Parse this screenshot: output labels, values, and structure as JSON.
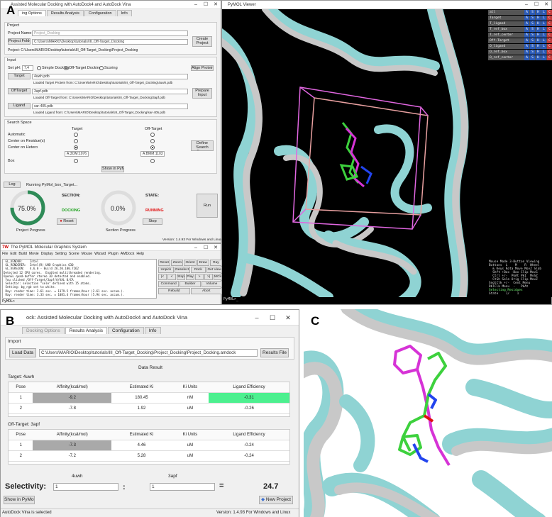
{
  "panels": {
    "a": "A",
    "b": "B",
    "c": "C"
  },
  "pymol_viewer_title": "PyMOL Viewer",
  "pymol_cmd_prompt": "PyMOL>_",
  "amdock_top": {
    "title": "Assisted Molecular Docking with AutoDock4 and AutoDock Vina",
    "tabs": [
      "ing Options",
      "Results Analysis",
      "Configuration",
      "Info"
    ],
    "project_section": "Project",
    "project_name_label": "Project Name:",
    "project_name_placeholder": "Project_Docking",
    "project_folder_btn": "Project Folder",
    "project_folder_value": "C:\\Users\\MARIO\\Desktop\\tutorials\\III_Off-Target_Docking",
    "create_project_btn": "Create Project",
    "project_path": "Project: C:\\Users\\MARIO\\Desktop\\tutorials\\III_Off-Target_Docking\\Project_Docking",
    "input_section": "Input",
    "set_ph_label": "Set pH:",
    "ph_value": "7,4",
    "mode_simple": "Simple Docking",
    "mode_offtarget": "Off-Target Docking",
    "mode_scoring": "Scoring",
    "align_btn": "Align Proteins",
    "target_btn": "Target",
    "target_value": "4uwh.pdb",
    "target_loaded": "Loaded Target Protein from: C:\\Users\\MARIO\\Desktop\\tutorials\\III_Off-Target_Docking\\4uwh.pdb",
    "offtarget_btn": "OffTarget",
    "offtarget_value": "3apf.pdb",
    "prepare_btn": "Prepare Input",
    "offtarget_loaded": "Loaded Off-Target from: C:\\Users\\MARIO\\Desktop\\tutorials\\III_Off-Target_Docking\\3apf.pdb",
    "ligand_btn": "Ligand",
    "ligand_value": "sar-405.pdb",
    "ligand_loaded": "Loaded Ligand from: C:\\Users\\MARIO\\Desktop\\tutorials\\III_Off-Target_Docking\\sar-405.pdb",
    "search_section": "Search Space",
    "col_target": "Target",
    "col_offtarget": "Off-Target",
    "row_automatic": "Automatic",
    "row_residue": "Center on Residue(s)",
    "row_hetero": "Center on Hetero",
    "row_box": "Box",
    "hetero_target": "A:3OM:1076",
    "hetero_offtarget": "A:BMM:1103",
    "define_btn": "Define Search Space",
    "show_pymol_btn": "Show in PyMol",
    "log_btn": "Log",
    "log_text": "Running PyMol_box_Target...",
    "section_label": "SECTION:",
    "section_value": "DOCKING",
    "state_label": "STATE:",
    "state_value": "RUNNING",
    "project_pct": "75.0%",
    "project_progress_label": "Project Progress",
    "section_pct": "0.0%",
    "section_progress_label": "Section Progress",
    "reset_btn": "Reset",
    "stop_btn": "Stop",
    "run_btn": "Run",
    "status": "AutoDock Vina is selected",
    "version": "Version: 1.4.93 For Windows and Linux"
  },
  "pymol_gui": {
    "title": "The PyMOL Molecular Graphics System",
    "menu": [
      "File",
      "Edit",
      "Build",
      "Movie",
      "Display",
      "Setting",
      "Scene",
      "Mouse",
      "Wizard",
      "Plugin",
      "AMDock",
      "Help"
    ],
    "console": [
      " GL_VENDOR:    Intel",
      " GL_RENDERER:  Intel(R) UHD Graphics 630",
      " GL_VERSION:   4.6.0 - Build 26.20.100.7262",
      "Detected 12 CPU cores.  Enabled multithreaded rendering.",
      "OpenGL quad-buffer stereo 3D detected and enabled.",
      " You clicked /Off-Target/3apf/A/VAL 0/CA",
      " Selector: selection \"sele\" defined with 15 atoms.",
      " Setting: bg_rgb set to white.",
      " Ray: render time: 2.61 sec. = 1379.5 frames/hour (2.61 sec. accum.).",
      " Ray: render time: 3.33 sec. = 1081.4 frames/hour (5.94 sec. accum.)."
    ],
    "prompt": "PyMOL>",
    "buttons": [
      [
        "Reset",
        "Zoom",
        "Orient",
        "Draw",
        "Ray"
      ],
      [
        "Unpick",
        "Deselect",
        "Rock",
        "Get View"
      ],
      [
        "|<",
        "<",
        "Stop",
        "Play",
        ">",
        ">|",
        "MClear"
      ],
      [
        "Command",
        "Builder",
        "Volume"
      ],
      [
        "Rebuild",
        "Abort"
      ]
    ]
  },
  "objects_panel": {
    "items": [
      "all",
      "Target",
      "T_ligand",
      "T_ref_box",
      "T_ref_center",
      "Off-Target",
      "O_ligand",
      "O_ref_box",
      "O_ref_center"
    ],
    "flags": [
      "A",
      "S",
      "H",
      "L",
      "C"
    ]
  },
  "mouse_mode": [
    "Mouse Mode 3-Button Viewing",
    "Buttons  L    M    R  Wheel",
    "  & Keys Rota Move MovZ Slab",
    "  Shft +Box -Box Clip MovS",
    "  Ctrl +/-  PkAt Pk1  MvSZ",
    "  CtSh Sele Orig Clip MovZ",
    "SnglClk +/-  Cent Menu",
    "DblClk Menu  -   PkAt",
    "Selecting Residues",
    "State    1/    1"
  ],
  "results": {
    "title": "ock: Assisted Molecular Docking with AutoDock4 and AutoDock Vina",
    "tabs": [
      "Docking Options",
      "Results Analysis",
      "Configuration",
      "Info"
    ],
    "import_label": "Import",
    "load_btn": "Load Data",
    "load_path": "C:\\Users\\MARIO\\Desktop\\tutorials\\III_Off-Target_Docking\\Project_Docking\\Project_Docking.amdock",
    "results_file_btn": "Results File",
    "data_result": "Data Result",
    "target_label": "Target: 4uwh",
    "offtarget_label": "Off-Target: 3apf",
    "headers": [
      "Pose",
      "Affinity(kcal/mol)",
      "Estimated Ki",
      "Ki Units",
      "Ligand Efficiency"
    ],
    "target_rows": [
      [
        "1",
        "-9.2",
        "180.45",
        "nM",
        "-0.31"
      ],
      [
        "2",
        "-7.8",
        "1.92",
        "uM",
        "-0.26"
      ]
    ],
    "offtarget_rows": [
      [
        "1",
        "-7.3",
        "4.46",
        "uM",
        "-0.24"
      ],
      [
        "2",
        "-7.2",
        "5.28",
        "uM",
        "-0.24"
      ]
    ],
    "sel_col1": "4uwh",
    "sel_col2": "3apf",
    "selectivity_label": "Selectivity:",
    "sel_val1": "1",
    "sel_val2": "1",
    "colon": ":",
    "equals": "=",
    "selectivity_value": "24.7",
    "show_pymol_btn": "Show in PyMol",
    "new_project_btn": "New Project",
    "status": "AutoDock Vina is selected",
    "version": "Version: 1.4.93 For Windows and Linux"
  },
  "colors": {
    "cyan_ribbon": "#8fd3d3",
    "grey_ribbon": "#c8c8c8",
    "ligand_green": "#3dd13d",
    "ligand_magenta": "#d633d6",
    "highlight_green": "#4cf08f",
    "docking_green": "#19a019",
    "running_red": "#e01010"
  }
}
